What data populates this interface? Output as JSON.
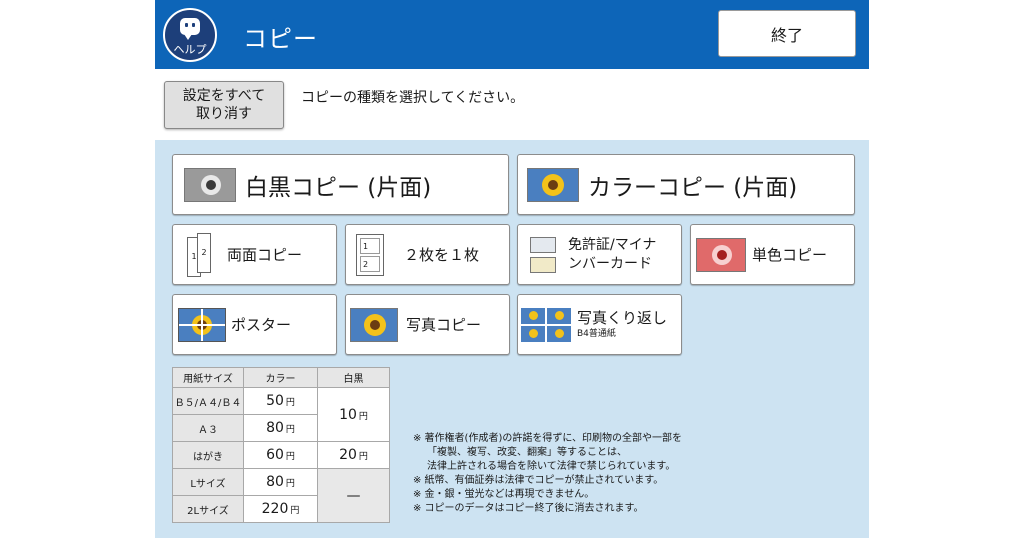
{
  "header": {
    "help_label": "ヘルプ",
    "title": "コピー",
    "exit_label": "終了"
  },
  "reset_button": {
    "line1": "設定をすべて",
    "line2": "取り消す"
  },
  "instruction": "コピーの種類を選択してください。",
  "copy_buttons": {
    "bw_single": "白黒コピー (片面)",
    "color_single": "カラーコピー (片面)",
    "duplex": "両面コピー",
    "two_in_one": "２枚を１枚",
    "license_line1": "免許証/マイナ",
    "license_line2": "ンバーカード",
    "mono_color": "単色コピー",
    "poster": "ポスター",
    "photo": "写真コピー",
    "photo_repeat": "写真くり返し",
    "photo_repeat_sub": "B4普通紙"
  },
  "price_table": {
    "headers": [
      "用紙サイズ",
      "カラー",
      "白黒"
    ],
    "unit": "円",
    "rows": [
      {
        "size": "Ｂ５/Ａ４/Ｂ４",
        "color": "50"
      },
      {
        "size": "Ａ３",
        "color": "80"
      },
      {
        "size": "はがき",
        "color": "60"
      },
      {
        "size": "Lサイズ",
        "color": "80"
      },
      {
        "size": "2Lサイズ",
        "color": "220"
      }
    ],
    "bw_values": [
      "10",
      "20",
      "—"
    ]
  },
  "notes": [
    "※ 著作権者(作成者)の許諾を得ずに、印刷物の全部や一部を",
    "「複製、複写、改変、翻案」等することは、",
    "法律上許される場合を除いて法律で禁じられています。",
    "※ 紙幣、有価証券は法律でコピーが禁止されています。",
    "※ 金・銀・蛍光などは再現できません。",
    "※ コピーのデータはコピー終了後に消去されます。"
  ],
  "colors": {
    "header_bg": "#0d65b8",
    "panel_bg": "#cde3f2",
    "help_icon_bg": "#1d3f7a"
  },
  "icons": [
    "help-chat-icon",
    "sunflower-mono-icon",
    "sunflower-color-icon",
    "duplex-pages-icon",
    "two-in-one-icon",
    "id-card-icon",
    "mono-color-sunflower-icon",
    "poster-icon",
    "photo-sunflower-icon",
    "photo-repeat-icon"
  ]
}
